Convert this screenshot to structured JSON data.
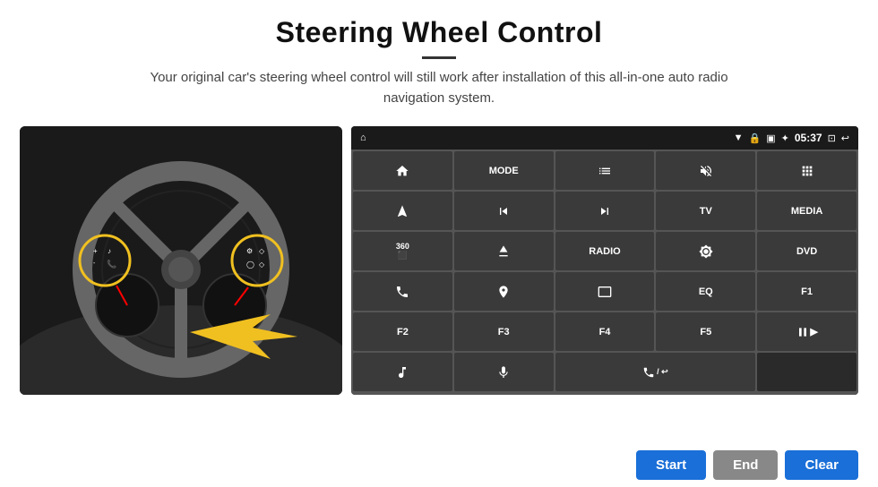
{
  "header": {
    "title": "Steering Wheel Control",
    "divider": true,
    "subtitle": "Your original car's steering wheel control will still work after installation of this all-in-one auto radio navigation system."
  },
  "status_bar": {
    "time": "05:37",
    "icons": [
      "wifi",
      "lock",
      "sim",
      "bluetooth",
      "battery",
      "cast",
      "back"
    ]
  },
  "grid_buttons": [
    {
      "id": "home",
      "icon": "home",
      "text": "",
      "type": "icon"
    },
    {
      "id": "mode",
      "icon": "",
      "text": "MODE",
      "type": "text"
    },
    {
      "id": "list",
      "icon": "list",
      "text": "",
      "type": "icon"
    },
    {
      "id": "mute",
      "icon": "mute",
      "text": "",
      "type": "icon"
    },
    {
      "id": "apps",
      "icon": "apps",
      "text": "",
      "type": "icon"
    },
    {
      "id": "navigate",
      "icon": "navigate",
      "text": "",
      "type": "icon"
    },
    {
      "id": "prev",
      "icon": "prev",
      "text": "",
      "type": "icon"
    },
    {
      "id": "next",
      "icon": "next",
      "text": "",
      "type": "icon"
    },
    {
      "id": "tv",
      "icon": "",
      "text": "TV",
      "type": "text"
    },
    {
      "id": "media",
      "icon": "",
      "text": "MEDIA",
      "type": "text"
    },
    {
      "id": "360",
      "icon": "360",
      "text": "",
      "type": "icon"
    },
    {
      "id": "eject",
      "icon": "eject",
      "text": "",
      "type": "icon"
    },
    {
      "id": "radio",
      "icon": "",
      "text": "RADIO",
      "type": "text"
    },
    {
      "id": "brightness",
      "icon": "brightness",
      "text": "",
      "type": "icon"
    },
    {
      "id": "dvd",
      "icon": "",
      "text": "DVD",
      "type": "text"
    },
    {
      "id": "phone",
      "icon": "phone",
      "text": "",
      "type": "icon"
    },
    {
      "id": "nav2",
      "icon": "nav2",
      "text": "",
      "type": "icon"
    },
    {
      "id": "screen",
      "icon": "screen",
      "text": "",
      "type": "icon"
    },
    {
      "id": "eq",
      "icon": "",
      "text": "EQ",
      "type": "text"
    },
    {
      "id": "f1",
      "icon": "",
      "text": "F1",
      "type": "text"
    },
    {
      "id": "f2",
      "icon": "",
      "text": "F2",
      "type": "text"
    },
    {
      "id": "f3",
      "icon": "",
      "text": "F3",
      "type": "text"
    },
    {
      "id": "f4",
      "icon": "",
      "text": "F4",
      "type": "text"
    },
    {
      "id": "f5",
      "icon": "",
      "text": "F5",
      "type": "text"
    },
    {
      "id": "playpause",
      "icon": "playpause",
      "text": "",
      "type": "icon"
    },
    {
      "id": "music",
      "icon": "music",
      "text": "",
      "type": "icon"
    },
    {
      "id": "mic",
      "icon": "mic",
      "text": "",
      "type": "icon"
    },
    {
      "id": "call",
      "icon": "call",
      "text": "",
      "type": "icon",
      "wide": true
    },
    {
      "id": "empty1",
      "icon": "",
      "text": "",
      "type": "empty"
    },
    {
      "id": "empty2",
      "icon": "",
      "text": "",
      "type": "empty"
    }
  ],
  "bottom_buttons": {
    "start_label": "Start",
    "end_label": "End",
    "clear_label": "Clear"
  }
}
